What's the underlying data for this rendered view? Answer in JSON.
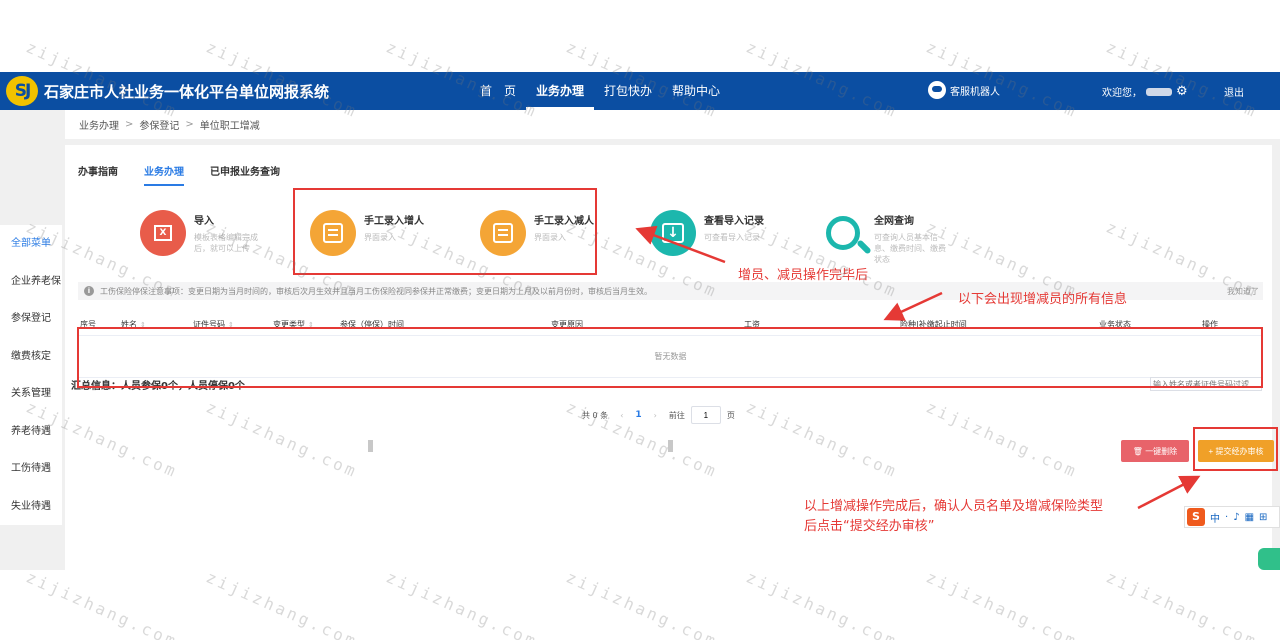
{
  "header": {
    "logo_text": "SJ",
    "system_title": "石家庄市人社业务一体化平台单位网报系统",
    "nav": [
      {
        "label": "首　页"
      },
      {
        "label": "业务办理"
      },
      {
        "label": "打包快办"
      },
      {
        "label": "帮助中心"
      }
    ],
    "robot_label": "客服机器人",
    "welcome": "欢迎您，",
    "logout": "退出"
  },
  "breadcrumb": [
    "业务办理",
    "参保登记",
    "单位职工增减"
  ],
  "sidemenu": [
    "全部菜单",
    "企业养老保",
    "参保登记",
    "缴费核定",
    "关系管理",
    "养老待遇",
    "工伤待遇",
    "失业待遇"
  ],
  "tabs": [
    "办事指南",
    "业务办理",
    "已申报业务查询"
  ],
  "functions": [
    {
      "title": "导入",
      "desc": "模板表格编辑完成后，就可以上传"
    },
    {
      "title": "手工录入增人",
      "desc": "界面录入"
    },
    {
      "title": "手工录入减人",
      "desc": "界面录入"
    },
    {
      "title": "查看导入记录",
      "desc": "可查看导入记录"
    },
    {
      "title": "全网查询",
      "desc": "可查询人员基本信息、缴费时间、缴费状态"
    }
  ],
  "annotations": {
    "a1": "增员、减员操作完毕后",
    "a2": "以下会出现增减员的所有信息",
    "a3_line1": "以上增减操作完成后，确认人员名单及增减保险类型",
    "a3_line2": "后点击“提交经办审核”"
  },
  "notice": {
    "text": "工伤保险停保注意事项：变更日期为当月时间的，审核后次月生效并且当月工伤保险视同参保并正常缴费；变更日期为上月及以前月份时，审核后当月生效。",
    "close": "我知道了"
  },
  "table": {
    "columns": [
      "序号",
      "姓名",
      "证件号码",
      "变更类型",
      "参保（停保）时间",
      "变更原因",
      "工资",
      "险种|补缴起止时间",
      "业务状态",
      "操作"
    ],
    "empty_text": "暂无数据"
  },
  "summary": "汇总信息：人员参保0个，人员停保0个",
  "filter_placeholder": "输入姓名或者证件号码过滤",
  "pagination": {
    "total": "共 0 条",
    "prev": "‹",
    "current": "1",
    "next": "›",
    "goto_label": "前往",
    "goto_value": "1",
    "page_suffix": "页"
  },
  "actions": {
    "remove": "一键删除",
    "submit": "提交经办审核"
  },
  "ime": {
    "logo": "S",
    "items": [
      "中",
      "·",
      "♪",
      "▦",
      "⊞"
    ]
  },
  "watermark": "zijizhang.com",
  "colors": {
    "header_bg": "#0b4ea2",
    "accent": "#2a7be4",
    "annotation_red": "#e53935",
    "submit_orange": "#f0a028",
    "remove_red": "#e8636a"
  }
}
